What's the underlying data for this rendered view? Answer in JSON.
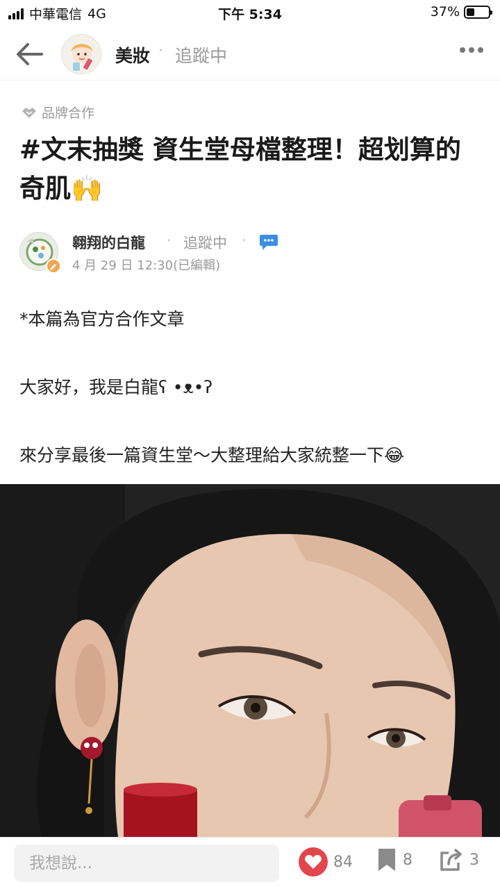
{
  "status_bar": {
    "carrier": "中華電信",
    "network": "4G",
    "time": "下午 5:34",
    "battery": "37%",
    "battery_level": 0.37
  },
  "nav": {
    "board_name": "美妝",
    "separator": "·",
    "follow_status": "追蹤中"
  },
  "post": {
    "sponsor_label": "品牌合作",
    "title": "#文末抽獎 資生堂母檔整理！超划算的奇肌🙌",
    "author": {
      "name": "翱翔的白龍",
      "separator": "·",
      "follow_status": "追蹤中",
      "date": "4 月 29 日 12:30(已編輯)"
    },
    "paragraphs": [
      "*本篇為官方合作文章",
      "大家好，我是白龍ʕ •ᴥ•ʔ",
      "來分享最後一篇資生堂～大整理給大家統整一下😂"
    ]
  },
  "bottom_bar": {
    "comment_placeholder": "我想說...",
    "like_count": "84",
    "bookmark_count": "8",
    "share_count": "3"
  },
  "colors": {
    "like_red": "#e2454b",
    "muted_text": "#9a9a9a",
    "chat_blue": "#3b8ee6"
  },
  "icons": [
    "back-arrow-icon",
    "more-icon",
    "handshake-icon",
    "chat-bubble-icon",
    "heart-icon",
    "bookmark-icon",
    "share-icon"
  ]
}
